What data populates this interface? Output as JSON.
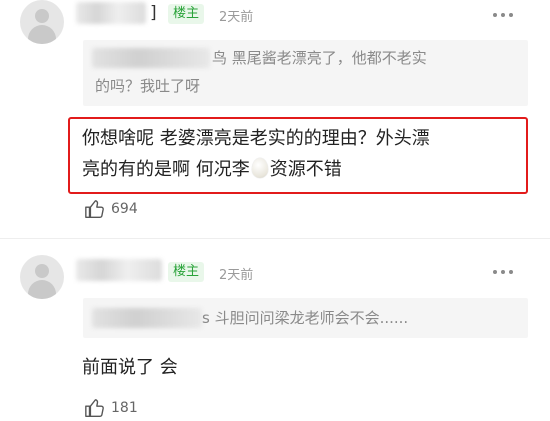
{
  "comments": [
    {
      "owner_badge": "楼主",
      "time": "2天前",
      "bracket": "]",
      "quote_line1": "鸟 黑尾酱老漂亮了，他都不老实",
      "quote_line2": "的吗？我吐了呀",
      "content_line1": "你想啥呢 老婆漂亮是老实的的理由？外头漂",
      "content_line2a": "亮的有的是啊 何况李",
      "content_line2b": "资源不错",
      "egg_icon": "egg-emoji",
      "likes": "694"
    },
    {
      "owner_badge": "楼主",
      "time": "2天前",
      "quote_suffix": "s 斗胆问问梁龙老师会不会......",
      "content": "前面说了 会",
      "likes": "181"
    }
  ],
  "colors": {
    "highlight": "#e21b1b",
    "badge_text": "#2aa33a",
    "badge_bg": "#e9f7ea"
  }
}
